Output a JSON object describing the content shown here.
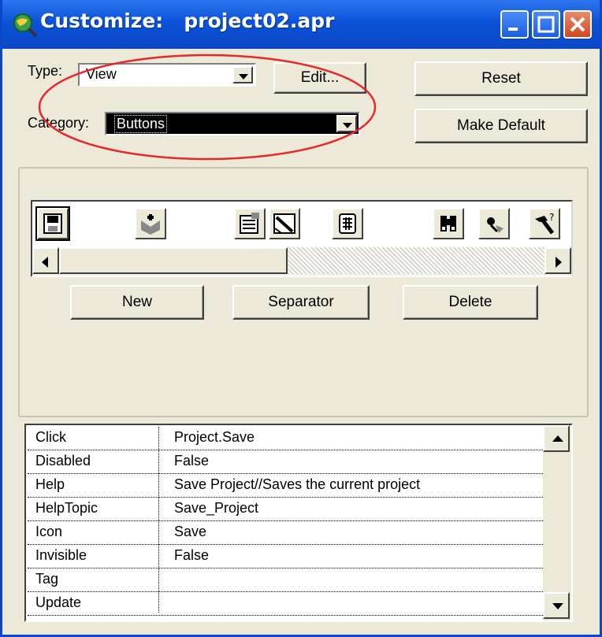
{
  "window": {
    "title_prefix": "Customize:",
    "title_file": "project02.apr"
  },
  "type": {
    "label": "Type:",
    "value": "View"
  },
  "category": {
    "label": "Category:",
    "value": "Buttons"
  },
  "buttons": {
    "edit": "Edit...",
    "reset": "Reset",
    "make_default": "Make Default",
    "new": "New",
    "separator": "Separator",
    "delete": "Delete"
  },
  "toolbar_icons": [
    "save-icon",
    "add-theme-icon",
    "properties-icon",
    "edit-legend-icon",
    "table-icon",
    "find-icon",
    "locate-address-icon",
    "hotlink-icon"
  ],
  "properties": [
    {
      "key": "Click",
      "value": "Project.Save"
    },
    {
      "key": "Disabled",
      "value": "False"
    },
    {
      "key": "Help",
      "value": "Save Project//Saves the current project"
    },
    {
      "key": "HelpTopic",
      "value": "Save_Project"
    },
    {
      "key": "Icon",
      "value": "Save"
    },
    {
      "key": "Invisible",
      "value": "False"
    },
    {
      "key": "Tag",
      "value": ""
    },
    {
      "key": "Update",
      "value": ""
    }
  ],
  "colors": {
    "titlebar": "#0a52d8",
    "window_bg": "#ece9d8",
    "selection": "#000000",
    "annotation": "#e8272a"
  }
}
